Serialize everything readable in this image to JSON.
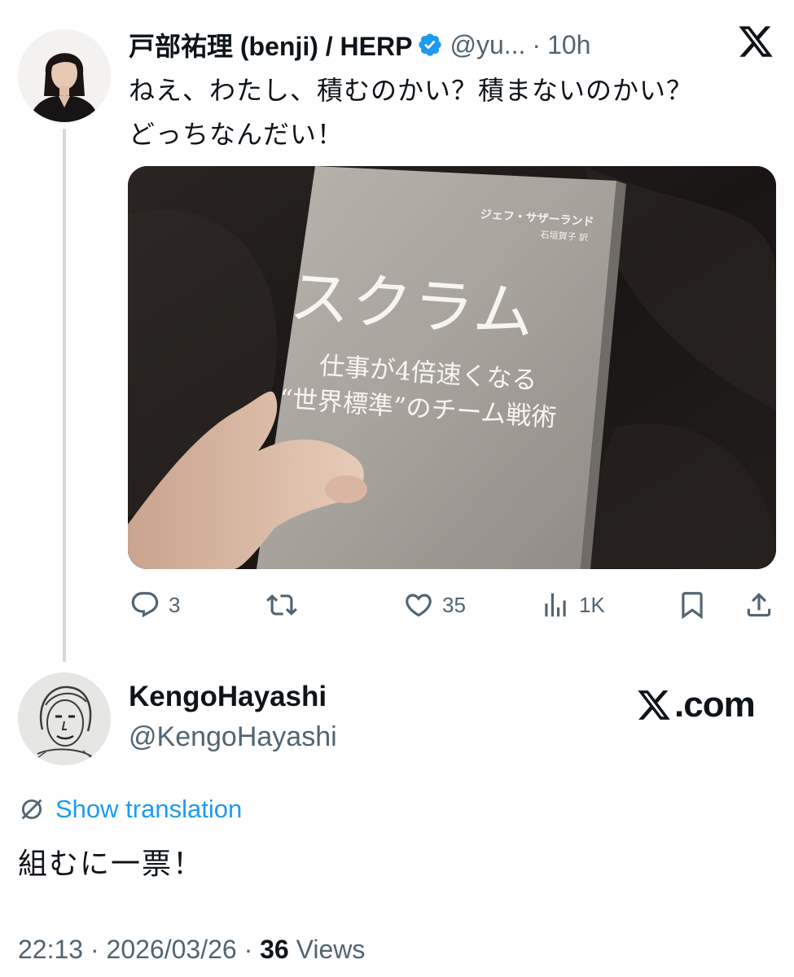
{
  "quoted_tweet": {
    "author_name": "戸部祐理 (benji) / HERP",
    "handle": "@yu...",
    "separator": "·",
    "time": "10h",
    "text": "ねえ、わたし、積むのかい？積まないのかい？\nどっちなんだい！",
    "image": {
      "book_author": "ジェフ・サザーランド",
      "book_translator": "石垣賀子 訳",
      "book_title": "スクラム",
      "book_subtitle_1": "仕事が4倍速くなる",
      "book_subtitle_2": "“世界標準”のチーム戦術"
    },
    "actions": {
      "replies": "3",
      "reposts": "",
      "likes": "35",
      "views": "1K"
    }
  },
  "reply": {
    "author_name": "KengoHayashi",
    "handle": "@KengoHayashi",
    "show_translation": "Show translation",
    "text": "組むに一票！",
    "time": "22:13",
    "date": "2026/03/26",
    "sep": "·",
    "views_count": "36",
    "views_label": "Views"
  },
  "branding": {
    "xcom_label": ".com"
  },
  "colors": {
    "accent": "#1d9bf0",
    "secondary_text": "#536471",
    "primary_text": "#0f1419",
    "thread_line": "#cfd9de"
  },
  "icons": [
    "verified-badge-icon",
    "x-logo-icon",
    "reply-icon",
    "repost-icon",
    "like-icon",
    "views-icon",
    "bookmark-icon",
    "share-icon",
    "translate-icon"
  ]
}
